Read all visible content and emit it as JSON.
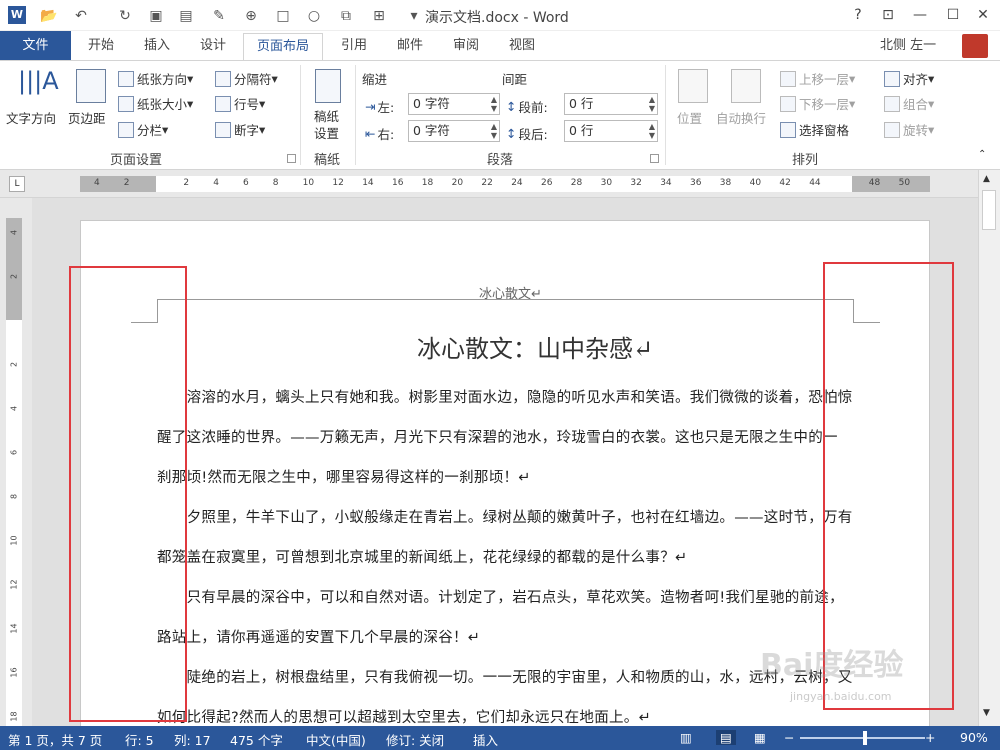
{
  "titlebar": {
    "title": "演示文档.docx - Word",
    "help": "?",
    "minimize": "—",
    "restore": "☐",
    "close": "✕"
  },
  "tabs": {
    "file": "文件",
    "items": [
      "开始",
      "插入",
      "设计",
      "页面布局",
      "引用",
      "邮件",
      "审阅",
      "视图"
    ],
    "active": "页面布局",
    "user": "北侧 左一"
  },
  "ribbon": {
    "page_setup": {
      "text_direction": "文字方向",
      "margins": "页边距",
      "orientation": "纸张方向",
      "size": "纸张大小",
      "columns": "分栏",
      "breaks": "分隔符",
      "line_numbers": "行号",
      "hyphenation": "断字",
      "group_label": "页面设置"
    },
    "draft": {
      "setup": "稿纸\n设置",
      "setup_line1": "稿纸",
      "setup_line2": "设置",
      "group_label": "稿纸"
    },
    "paragraph": {
      "indent_header": "缩进",
      "spacing_header": "间距",
      "left_label": "左:",
      "left_value": "0 字符",
      "right_label": "右:",
      "right_value": "0 字符",
      "before_label": "段前:",
      "before_value": "0 行",
      "after_label": "段后:",
      "after_value": "0 行",
      "group_label": "段落"
    },
    "arrange": {
      "position": "位置",
      "wrap": "自动换行",
      "bring_forward": "上移一层",
      "send_backward": "下移一层",
      "selection_pane": "选择窗格",
      "align": "对齐",
      "group": "组合",
      "rotate": "旋转",
      "group_label": "排列"
    }
  },
  "ruler": {
    "corner": "L",
    "h_ticks": [
      "4",
      "2",
      "",
      "2",
      "4",
      "6",
      "8",
      "10",
      "12",
      "14",
      "16",
      "18",
      "20",
      "22",
      "24",
      "26",
      "28",
      "30",
      "32",
      "34",
      "36",
      "38",
      "40",
      "42",
      "44",
      "",
      "48",
      "50"
    ],
    "v_ticks": [
      "4",
      "2",
      "",
      "2",
      "4",
      "6",
      "8",
      "10",
      "12",
      "14",
      "16",
      "18"
    ]
  },
  "document": {
    "header": "冰心散文↵",
    "title": "冰心散文：山中杂感↵",
    "lines": [
      "　　溶溶的水月，螭头上只有她和我。树影里对面水边，隐隐的听见水声和笑语。我们微微的谈着，恐怕惊",
      "醒了这浓睡的世界。——万籁无声，月光下只有深碧的池水，玲珑雪白的衣裳。这也只是无限之生中的一",
      "刹那顷!然而无限之生中，哪里容易得这样的一刹那顷！↵",
      "　　夕照里，牛羊下山了，小蚁般缘走在青岩上。绿树丛颠的嫩黄叶子，也衬在红墙边。——这时节，万有",
      "都笼盖在寂寞里，可曾想到北京城里的新闻纸上，花花绿绿的都载的是什么事？↵",
      "　　只有早晨的深谷中，可以和自然对语。计划定了，岩石点头，草花欢笑。造物者呵!我们星驰的前途，",
      "路站上，请你再遥遥的安置下几个早晨的深谷！↵",
      "　　陡绝的岩上，树根盘结里，只有我俯视一切。一一无限的宇宙里，人和物质的山，水，远村，云树，又",
      "如何比得起?然而人的思想可以超越到太空里去，它们却永远只在地面上。↵"
    ]
  },
  "status": {
    "page": "第 1 页，共 7 页",
    "line": "行: 5",
    "column": "列: 17",
    "words": "475 个字",
    "language": "中文(中国)",
    "track": "修订: 关闭",
    "mode": "插入",
    "zoom_minus": "−",
    "zoom_plus": "+",
    "zoom": "90%",
    "zoom_level": 0.9
  },
  "watermark": {
    "main": "Bai度经验",
    "sub": "jingyan.baidu.com"
  },
  "colors": {
    "accent": "#2b579a",
    "highlight": "#e0393e"
  }
}
